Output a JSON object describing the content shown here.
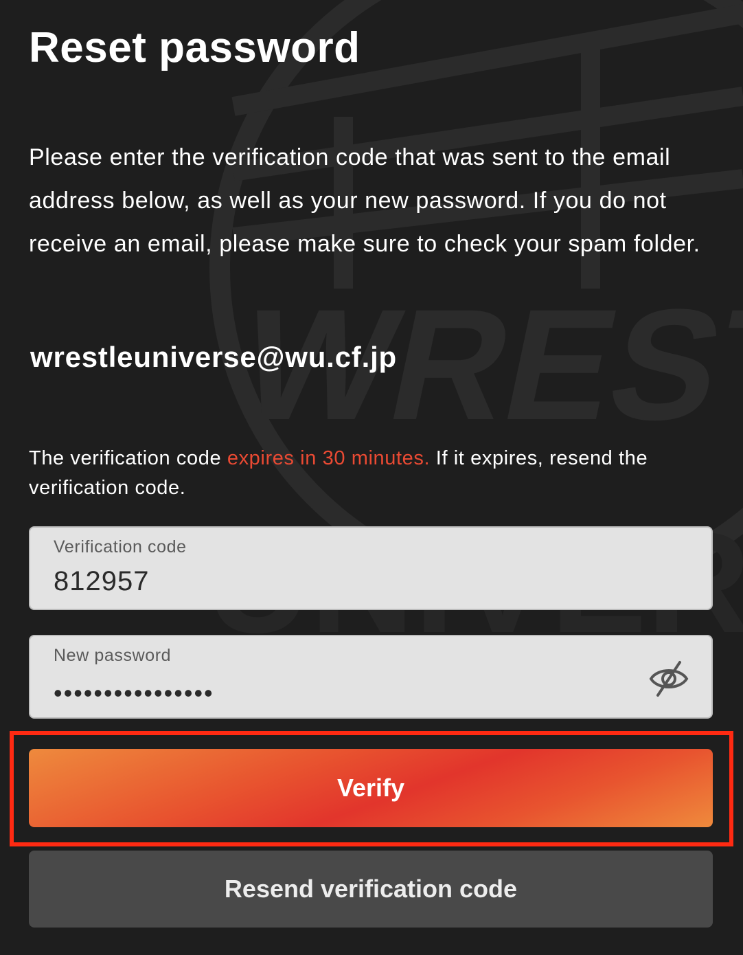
{
  "page": {
    "title": "Reset password",
    "instructions": "Please enter the verification code that was sent to the email address below, as well as your new password. If you do not receive an email, please make sure to check your spam folder.",
    "email": "wrestleuniverse@wu.cf.jp"
  },
  "expiry_note": {
    "prefix": "The verification code ",
    "highlight": "expires in 30 minutes.",
    "suffix": " If it expires, resend the verification code."
  },
  "form": {
    "code_field": {
      "label": "Verification code",
      "value": "812957"
    },
    "password_field": {
      "label": "New password",
      "value": "••••••••••••••••",
      "toggle_icon": "eye-slash-icon"
    }
  },
  "buttons": {
    "verify_label": "Verify",
    "resend_label": "Resend verification code"
  },
  "colors": {
    "background": "#1e1e1e",
    "accent_text": "#ea4a33",
    "highlight_frame": "#ff2a12",
    "verify_gradient_start": "#ee8a3d",
    "verify_gradient_mid": "#e2352c",
    "resend_button": "#494949",
    "field_background": "#e3e3e3"
  },
  "watermark": {
    "word_top": "WREST",
    "word_bottom": "UNIVER"
  }
}
